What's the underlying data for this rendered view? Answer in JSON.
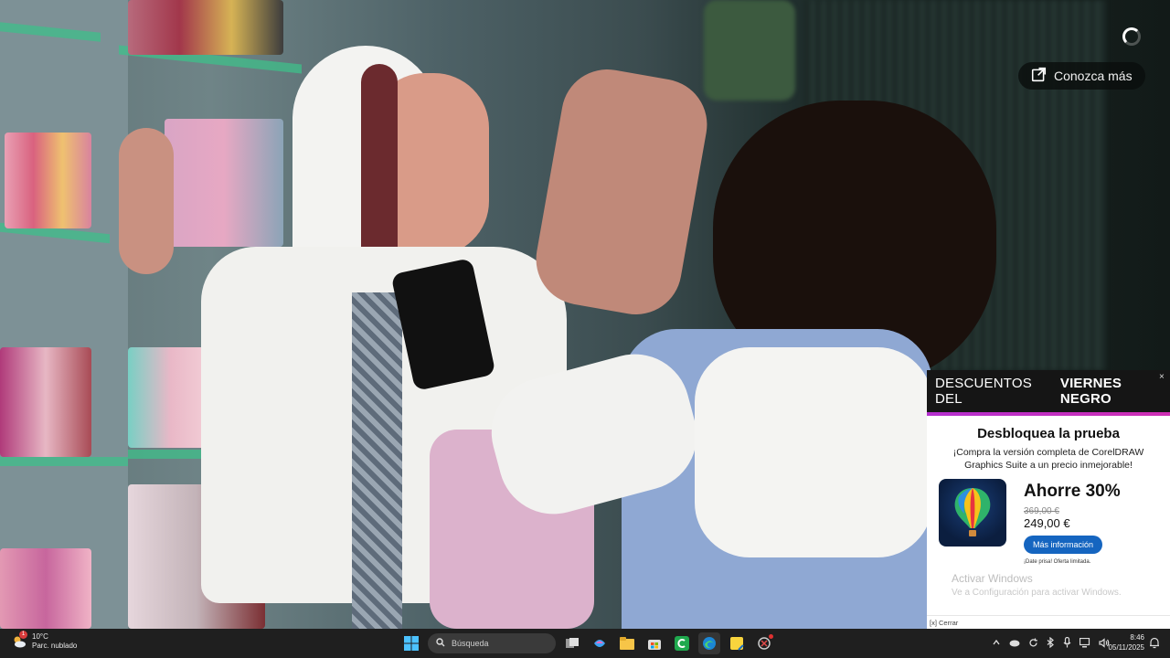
{
  "video": {
    "learn_more_label": "Conozca más"
  },
  "ad": {
    "header_normal": "DESCUENTOS DEL",
    "header_bold": "VIERNES NEGRO",
    "close_label": "×",
    "title": "Desbloquea la prueba",
    "description": "¡Compra la versión completa de CorelDRAW Graphics Suite a un precio inmejorable!",
    "save_text": "Ahorre 30%",
    "old_price": "369,00 €",
    "new_price": "249,00 €",
    "cta_label": "Más información",
    "fine_print": "¡Date prisa! Oferta limitada.",
    "footer_close": "[x] Cerrar"
  },
  "windows_watermark": {
    "line1": "Activar Windows",
    "line2": "Ve a Configuración para activar Windows."
  },
  "taskbar": {
    "weather_temp": "10°C",
    "weather_desc": "Parc. nublado",
    "weather_badge": "1",
    "search_placeholder": "Búsqueda",
    "time": "8:46",
    "date": "05/11/2025"
  },
  "colors": {
    "ad_accent": "#c02fc8",
    "cta_blue": "#1565c0",
    "taskbar_bg": "#1f1f1f"
  }
}
